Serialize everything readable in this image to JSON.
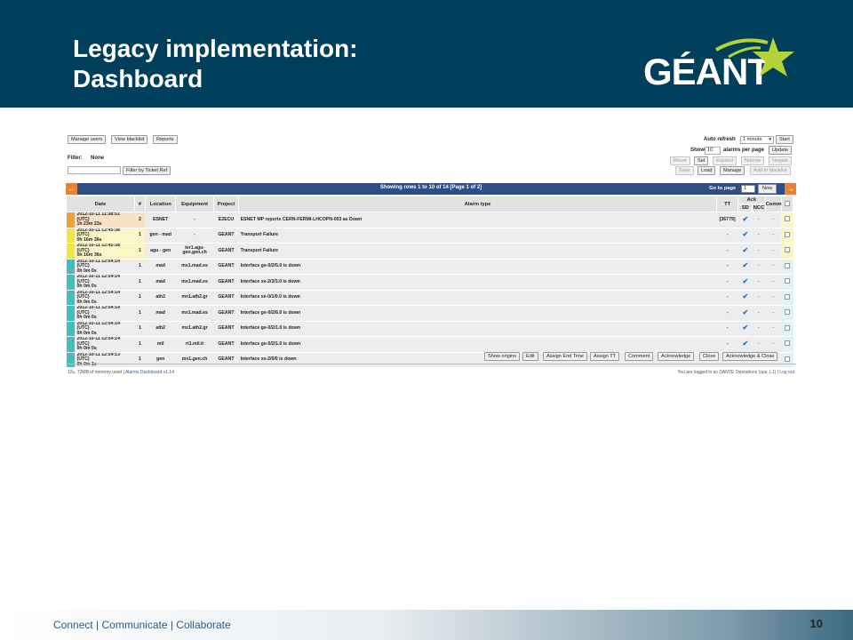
{
  "slide": {
    "title_line1": "Legacy implementation:",
    "title_line2": "Dashboard",
    "logo_text": "GÉANT",
    "footer": "Connect | Communicate | Collaborate",
    "page_number": "10",
    "colors": {
      "header_bg": "#003f5c",
      "logo_star": "#b5d334",
      "pager_bg": "#2d4f86",
      "pager_arrow": "#e9803b"
    }
  },
  "dashboard": {
    "top_buttons": [
      "Manage users",
      "View blacklist",
      "Reports"
    ],
    "filter_label": "Filter:",
    "filter_value": "None",
    "filter_button": "Filter by Ticket Ref",
    "auto_refresh_label": "Auto refresh",
    "auto_refresh_value": "1 minute",
    "start_button": "Start",
    "show_label": "Show",
    "show_value": "10",
    "alarms_per_page_label": "alarms per page",
    "update_button": "Update",
    "row_buttons_1": [
      "Reset",
      "Set",
      "Expand",
      "Narrow",
      "Negate"
    ],
    "row_buttons_2": [
      "Save",
      "Load",
      "Manage",
      "Add to blacklist"
    ],
    "pager_text": "Showing rows 1 to 10 of 14 [Page 1 of 2]",
    "goto_label": "Go to page",
    "goto_value": "1",
    "now_button": "Now",
    "columns": {
      "date": "Date",
      "count": "#",
      "location": "Location",
      "equipment": "Equipment",
      "project": "Project",
      "alarm_type": "Alarm type",
      "tt": "TT",
      "ack": "Ack",
      "sd": "SD",
      "ncc": "NCC",
      "comm": "Comm"
    },
    "rows": [
      {
        "severity": "#f0a13c",
        "date1": "2012-10-11 11:38:51 (UTC)",
        "date2": "1h 23m 23s",
        "count": "2",
        "location": "ESNET",
        "equipment": "-",
        "project": "E2ECU",
        "alarm": "ESNET MP reports CERN-FERMI-LHCOPN-003 as Down",
        "tt": "[36779]",
        "ncc": "-",
        "comm": "-"
      },
      {
        "severity": "#f3e24a",
        "date1": "2012-10-11 12:45:38 (UTC)",
        "date2": "0h 16m 36s",
        "count": "1",
        "location": "gen - mad",
        "equipment": "-",
        "project": "GEANT",
        "alarm": "Transport Failure",
        "tt": "-",
        "ncc": "-",
        "comm": "-"
      },
      {
        "severity": "#f3e24a",
        "date1": "2012-10-11 12:45:38 (UTC)",
        "date2": "0h 16m 36s",
        "count": "1",
        "location": "agu - gen",
        "equipment": "ter1.agu-gen.gen.ch",
        "project": "GEANT",
        "alarm": "Transport Failure",
        "tt": "-",
        "ncc": "-",
        "comm": "-"
      },
      {
        "severity": "#43bcc2",
        "date1": "2012-10-11 12:54:14 (UTC)",
        "date2": "0h 0m 0s",
        "count": "1",
        "location": "mad",
        "equipment": "mx1.mad.es",
        "project": "GEANT",
        "alarm": "Interface ge-0/2/5.0 is down",
        "tt": "-",
        "ncc": "-",
        "comm": "-"
      },
      {
        "severity": "#43bcc2",
        "date1": "2012-10-11 12:54:14 (UTC)",
        "date2": "0h 0m 0s",
        "count": "1",
        "location": "mad",
        "equipment": "mx1.mad.es",
        "project": "GEANT",
        "alarm": "Interface xe-2/3/3.0 is down",
        "tt": "-",
        "ncc": "-",
        "comm": "-"
      },
      {
        "severity": "#43bcc2",
        "date1": "2012-10-11 12:54:14 (UTC)",
        "date2": "0h 0m 0s",
        "count": "1",
        "location": "ath2",
        "equipment": "mx1.ath2.gr",
        "project": "GEANT",
        "alarm": "Interface xe-0/1/0.0 is down",
        "tt": "-",
        "ncc": "-",
        "comm": "-"
      },
      {
        "severity": "#43bcc2",
        "date1": "2012-10-11 12:54:14 (UTC)",
        "date2": "0h 0m 0s",
        "count": "1",
        "location": "mad",
        "equipment": "mx1.mad.es",
        "project": "GEANT",
        "alarm": "Interface ge-0/2/6.0 is down",
        "tt": "-",
        "ncc": "-",
        "comm": "-"
      },
      {
        "severity": "#43bcc2",
        "date1": "2012-10-11 12:54:14 (UTC)",
        "date2": "0h 0m 0s",
        "count": "1",
        "location": "ath2",
        "equipment": "mx1.ath2.gr",
        "project": "GEANT",
        "alarm": "Interface ge-0/2/1.0 is down",
        "tt": "-",
        "ncc": "-",
        "comm": "-"
      },
      {
        "severity": "#43bcc2",
        "date1": "2012-10-11 12:54:14 (UTC)",
        "date2": "0h 0m 0s",
        "count": "1",
        "location": "mil",
        "equipment": "rt1.mil.it",
        "project": "GEANT",
        "alarm": "Interface ge-5/2/1.0 is down",
        "tt": "-",
        "ncc": "-",
        "comm": "-"
      },
      {
        "severity": "#43bcc2",
        "date1": "2012-10-11 12:54:13 (UTC)",
        "date2": "0h 0m 1s",
        "count": "1",
        "location": "gen",
        "equipment": "mx1.gen.ch",
        "project": "GEANT",
        "alarm": "Interface xe-2/0/0 is down",
        "tt": "-",
        "ncc": "-",
        "comm": "-"
      }
    ],
    "action_buttons": [
      "Show origins",
      "Edit",
      "Assign End Time",
      "Assign TT",
      "Comment",
      "Acknowledge",
      "Close",
      "Acknowledge & Close"
    ],
    "status_left_prefix": "12s, 73MB of memory used |",
    "status_left_link": "Alarms Dashboard v1.14",
    "status_right_prefix": "You are logged in as DANTE Operations (ops, L1) |",
    "status_right_link": "Log out"
  }
}
